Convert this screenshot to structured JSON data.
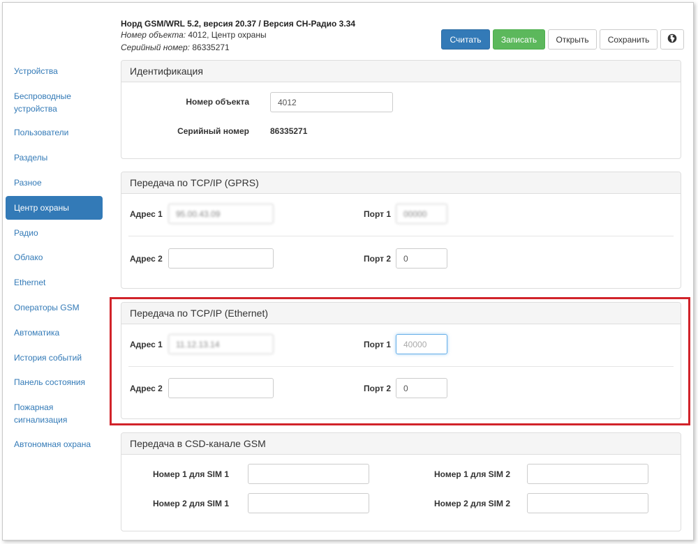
{
  "header": {
    "title": "Норд GSM/WRL 5.2, версия 20.37 / Версия СН-Радио 3.34",
    "object_label": "Номер объекта:",
    "object_value": "4012, Центр охраны",
    "serial_label": "Серийный номер:",
    "serial_value": "86335271"
  },
  "toolbar": {
    "read_label": "Считать",
    "write_label": "Записать",
    "open_label": "Открыть",
    "save_label": "Сохранить",
    "language_icon": "globe-icon"
  },
  "sidebar": {
    "active": "Центр охраны",
    "items": [
      {
        "label": "Устройства"
      },
      {
        "label": "Беспроводные устройства"
      },
      {
        "label": "Пользователи"
      },
      {
        "label": "Разделы"
      },
      {
        "label": "Разное"
      },
      {
        "label": "Центр охраны"
      },
      {
        "label": "Радио"
      },
      {
        "label": "Облако"
      },
      {
        "label": "Ethernet"
      },
      {
        "label": "Операторы GSM"
      },
      {
        "label": "Автоматика"
      },
      {
        "label": "История событий"
      },
      {
        "label": "Панель состояния"
      },
      {
        "label": "Пожарная сигнализация"
      },
      {
        "label": "Автономная охрана"
      }
    ]
  },
  "identification": {
    "heading": "Идентификация",
    "object_label": "Номер объекта",
    "object_value": "4012",
    "serial_label": "Серийный номер",
    "serial_value": "86335271"
  },
  "gprs": {
    "heading": "Передача по TCP/IP (GPRS)",
    "addr1_label": "Адрес 1",
    "addr1_value": "95.00.43.09",
    "port1_label": "Порт 1",
    "port1_value": "00000",
    "addr2_label": "Адрес 2",
    "addr2_value": "",
    "port2_label": "Порт 2",
    "port2_value": "0"
  },
  "ethernet": {
    "heading": "Передача по TCP/IP (Ethernet)",
    "addr1_label": "Адрес 1",
    "addr1_value": "11.12.13.14",
    "port1_label": "Порт 1",
    "port1_value": "40000",
    "addr2_label": "Адрес 2",
    "addr2_value": "",
    "port2_label": "Порт 2",
    "port2_value": "0"
  },
  "csd": {
    "heading": "Передача в CSD-канале GSM",
    "n1_sim1_label": "Номер 1 для SIM 1",
    "n1_sim1_value": "",
    "n1_sim2_label": "Номер 1 для SIM 2",
    "n1_sim2_value": "",
    "n2_sim1_label": "Номер 2 для SIM 1",
    "n2_sim1_value": "",
    "n2_sim2_label": "Номер 2 для SIM 2",
    "n2_sim2_value": ""
  },
  "colors": {
    "primary": "#337ab7",
    "success": "#5cb85c",
    "highlight": "#d1232a"
  }
}
